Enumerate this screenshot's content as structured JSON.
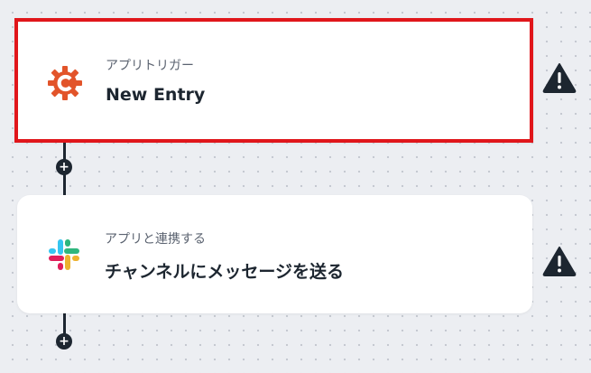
{
  "flow": {
    "steps": [
      {
        "label": "アプリトリガー",
        "title": "New Entry",
        "icon": "cognito-forms-icon",
        "selected": true
      },
      {
        "label": "アプリと連携する",
        "title": "チャンネルにメッセージを送る",
        "icon": "slack-icon",
        "selected": false
      }
    ],
    "add_step_symbol": "+",
    "warning_icon": "warning-icon"
  },
  "colors": {
    "selected_border": "#e0161b",
    "connector": "#1d2630",
    "warning": "#1d2630",
    "cognito_orange": "#e2542a",
    "slack_blue": "#36c5f0",
    "slack_green": "#2eb67d",
    "slack_red": "#e01e5a",
    "slack_yellow": "#ecb22e"
  }
}
